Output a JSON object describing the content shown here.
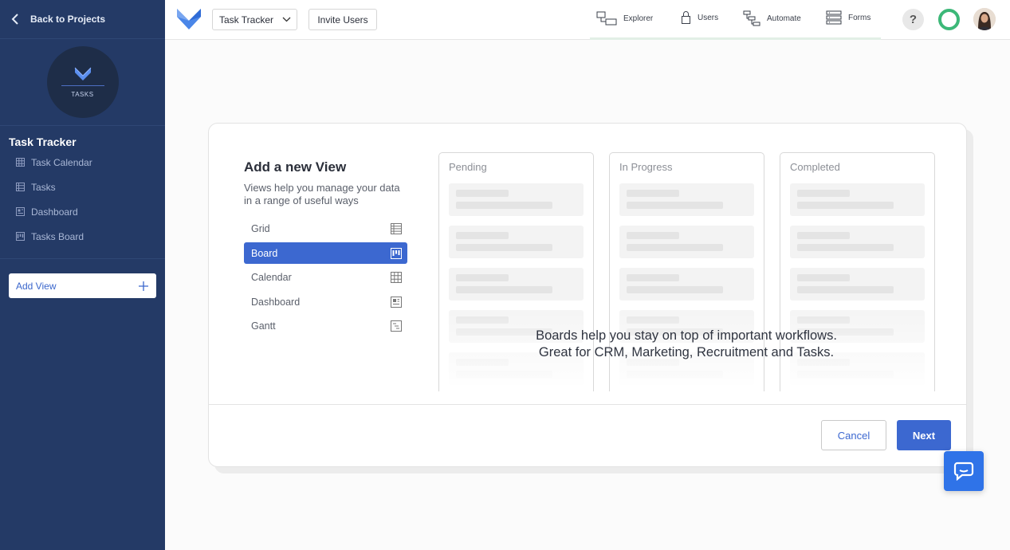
{
  "sidebar": {
    "back_label": "Back to Projects",
    "logo_text": "TASKS",
    "project_title": "Task Tracker",
    "items": [
      {
        "label": "Task Calendar",
        "icon": "calendar-grid-icon"
      },
      {
        "label": "Tasks",
        "icon": "grid-icon"
      },
      {
        "label": "Dashboard",
        "icon": "dashboard-icon"
      },
      {
        "label": "Tasks Board",
        "icon": "board-icon"
      }
    ],
    "add_view_label": "Add View"
  },
  "topbar": {
    "project_select": "Task Tracker",
    "invite_label": "Invite Users",
    "nav": [
      {
        "label": "Explorer",
        "icon": "explorer-icon"
      },
      {
        "label": "Users",
        "icon": "lock-icon"
      },
      {
        "label": "Automate",
        "icon": "automate-icon"
      },
      {
        "label": "Forms",
        "icon": "forms-icon"
      }
    ],
    "help_label": "?"
  },
  "modal": {
    "title": "Add a new View",
    "subtitle": "Views help you manage your data in a range of useful ways",
    "options": [
      {
        "label": "Grid",
        "icon": "grid-icon",
        "active": false
      },
      {
        "label": "Board",
        "icon": "board-icon",
        "active": true
      },
      {
        "label": "Calendar",
        "icon": "calendar-icon",
        "active": false
      },
      {
        "label": "Dashboard",
        "icon": "dashboard-icon",
        "active": false
      },
      {
        "label": "Gantt",
        "icon": "gantt-icon",
        "active": false
      }
    ],
    "columns": [
      "Pending",
      "In Progress",
      "Completed"
    ],
    "description_line1": "Boards help you stay on top of important workflows.",
    "description_line2": "Great for CRM, Marketing, Recruitment and Tasks.",
    "cancel_label": "Cancel",
    "next_label": "Next"
  },
  "colors": {
    "sidebar_bg": "#243a66",
    "accent": "#3c68d0",
    "chat_button": "#2f73e8",
    "progress_ring": "#3cb878"
  }
}
